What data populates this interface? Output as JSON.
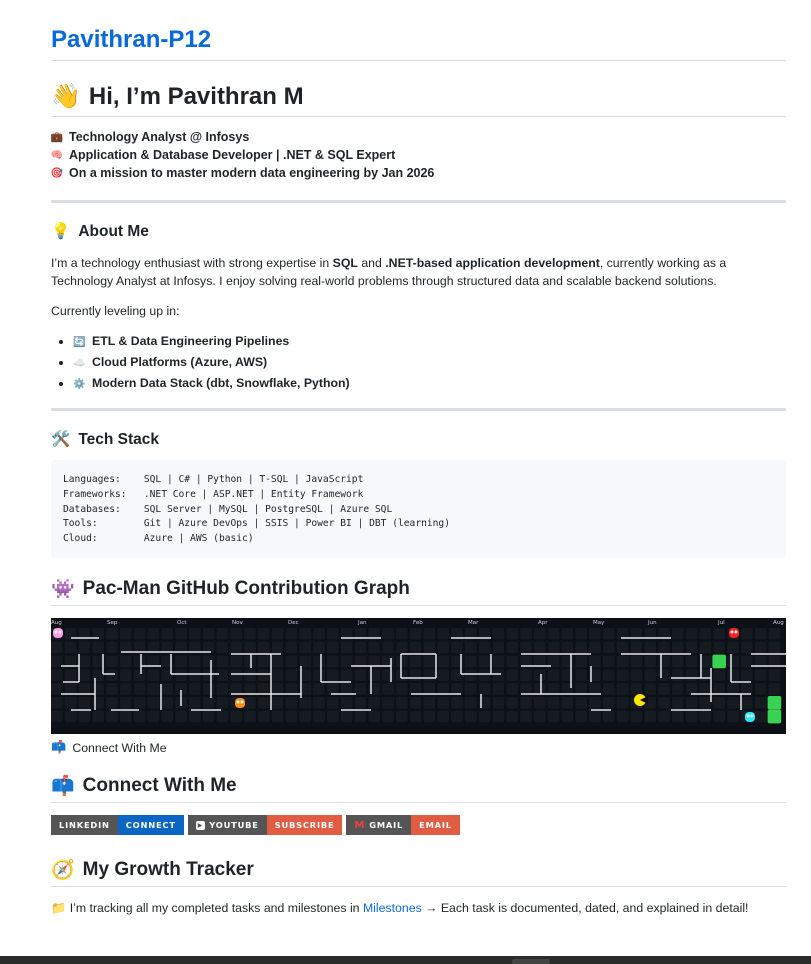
{
  "repo": {
    "title": "Pavithran-P12"
  },
  "intro": {
    "heading": "Hi, I’m Pavithran M",
    "wave": "👋",
    "lines": [
      {
        "icon": "💼",
        "text": "Technology Analyst @ Infosys"
      },
      {
        "icon": "🧠",
        "text": "Application & Database Developer | .NET & SQL Expert"
      },
      {
        "icon": "🎯",
        "text": "On a mission to master modern data engineering by Jan 2026"
      }
    ]
  },
  "about": {
    "heading": "About Me",
    "icon": "💡",
    "p1_a": "I’m a technology enthusiast with strong expertise in ",
    "p1_b": "SQL",
    "p1_c": " and ",
    "p1_d": ".NET-based application development",
    "p1_e": ", currently working as a Technology",
    "p1_f": "Analyst at Infosys. I enjoy solving real-world problems through structured data and scalable backend solutions.",
    "p2": "Currently leveling up in:",
    "items": [
      {
        "icon": "🔄",
        "text": "ETL & Data Engineering Pipelines"
      },
      {
        "icon": "☁️",
        "text": "Cloud Platforms (Azure, AWS)"
      },
      {
        "icon": "⚙️",
        "text": "Modern Data Stack (dbt, Snowflake, Python)"
      }
    ]
  },
  "stack": {
    "heading": "Tech Stack",
    "icon": "🛠️",
    "code": "Languages:    SQL | C# | Python | T-SQL | JavaScript\nFrameworks:   .NET Core | ASP.NET | Entity Framework\nDatabases:    SQL Server | MySQL | PostgreSQL | Azure SQL\nTools:        Git | Azure DevOps | SSIS | Power BI | DBT (learning)\nCloud:        Azure | AWS (basic)"
  },
  "pacman": {
    "heading": "Pac-Man GitHub Contribution Graph",
    "icon": "👾",
    "months": [
      "Aug",
      "Sep",
      "Oct",
      "Nov",
      "Dec",
      "Jan",
      "Feb",
      "Mar",
      "Apr",
      "May",
      "Jun",
      "Jul",
      "Aug"
    ],
    "caption": "Connect With Me",
    "caption_icon": "📫"
  },
  "connect": {
    "heading": "Connect With Me",
    "icon": "📫",
    "badges": [
      {
        "left": "LINKEDIN",
        "right": "CONNECT",
        "color": "#0a66c2",
        "icon": ""
      },
      {
        "left": "YOUTUBE",
        "right": "SUBSCRIBE",
        "color": "#e05d44",
        "icon": "▶"
      },
      {
        "left": "GMAIL",
        "right": "EMAIL",
        "color": "#e05d44",
        "icon": "M"
      }
    ]
  },
  "growth": {
    "heading": "My Growth Tracker",
    "icon": "🧭",
    "line_icon": "📁",
    "text_a": "I’m tracking all my completed tasks and milestones in ",
    "link": "Milestones",
    "text_b": " → Each task is documented, dated, and explained in detail!"
  }
}
